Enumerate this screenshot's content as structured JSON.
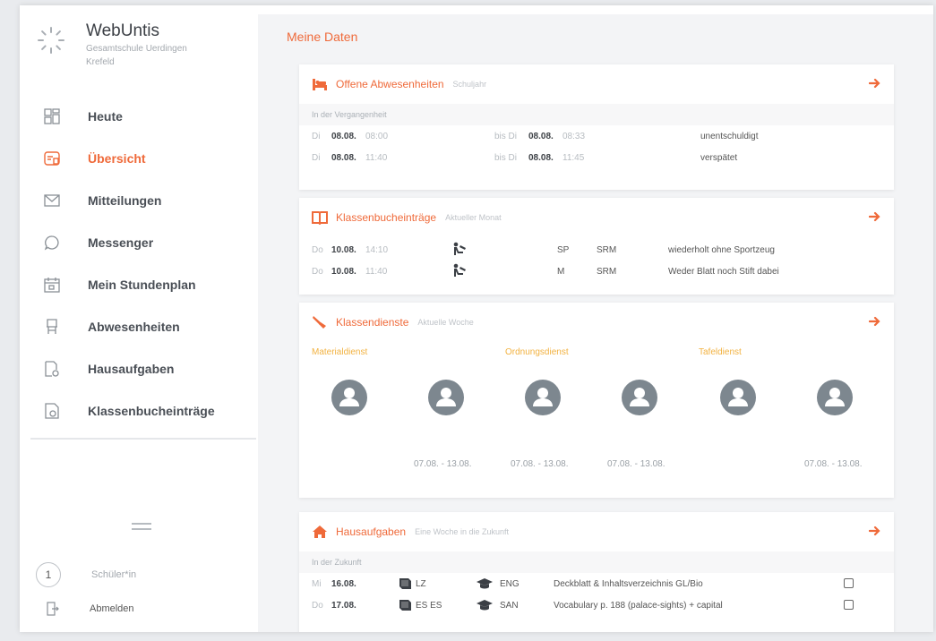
{
  "app": {
    "brand": "WebUntis",
    "school_line1": "Gesamtschule Uerdingen",
    "school_line2": "Krefeld"
  },
  "sidebar": {
    "items": [
      {
        "label": "Heute",
        "icon": "dashboard-icon",
        "active": false
      },
      {
        "label": "Übersicht",
        "icon": "overview-icon",
        "active": true
      },
      {
        "label": "Mitteilungen",
        "icon": "mail-icon",
        "active": false
      },
      {
        "label": "Messenger",
        "icon": "chat-bubble-icon",
        "active": false
      },
      {
        "label": "Mein Stundenplan",
        "icon": "calendar-icon",
        "active": false
      },
      {
        "label": "Abwesenheiten",
        "icon": "chair-icon",
        "active": false
      },
      {
        "label": "Hausaufgaben",
        "icon": "homework-icon",
        "active": false
      },
      {
        "label": "Klassenbucheinträge",
        "icon": "class-register-icon",
        "active": false
      }
    ],
    "user_number": "1",
    "user_role": "Schüler*in",
    "logout_label": "Abmelden"
  },
  "main": {
    "page_title": "Meine Daten",
    "absences": {
      "title": "Offene Abwesenheiten",
      "subtitle": "Schuljahr",
      "section": "In der Vergangenheit",
      "rows": [
        {
          "day": "Di",
          "date": "08.08.",
          "time": "08:00",
          "to_prefix": "bis Di",
          "to_date": "08.08.",
          "to_time": "08:33",
          "status": "unentschuldigt"
        },
        {
          "day": "Di",
          "date": "08.08.",
          "time": "11:40",
          "to_prefix": "bis Di",
          "to_date": "08.08.",
          "to_time": "11:45",
          "status": "verspätet"
        }
      ]
    },
    "classbook": {
      "title": "Klassenbucheinträge",
      "subtitle": "Aktueller Monat",
      "rows": [
        {
          "day": "Do",
          "date": "10.08.",
          "time": "14:10",
          "subject": "SP",
          "teacher": "SRM",
          "text": "wiederholt ohne Sportzeug"
        },
        {
          "day": "Do",
          "date": "10.08.",
          "time": "11:40",
          "subject": "M",
          "teacher": "SRM",
          "text": "Weder Blatt noch Stift dabei"
        }
      ]
    },
    "duties": {
      "title": "Klassendienste",
      "subtitle": "Aktuelle Woche",
      "labels": [
        "Materialdienst",
        "Ordnungsdienst",
        "Tafeldienst"
      ],
      "dates": [
        "07.08. - 13.08.",
        "07.08. - 13.08.",
        "07.08. - 13.08.",
        "07.08. - 13.08."
      ]
    },
    "homework": {
      "title": "Hausaufgaben",
      "subtitle": "Eine Woche in die Zukunft",
      "section": "In der Zukunft",
      "rows": [
        {
          "day": "Mi",
          "date": "16.08.",
          "course": "LZ",
          "subject": "ENG",
          "text": "Deckblatt & Inhaltsverzeichnis GL/Bio"
        },
        {
          "day": "Do",
          "date": "17.08.",
          "course": "ES ES",
          "subject": "SAN",
          "text": "Vocabulary p. 188 (palace-sights) + capital"
        }
      ]
    }
  },
  "colors": {
    "accent": "#ef6a3a",
    "duty": "#f2b241",
    "avatar": "#7d878f"
  }
}
